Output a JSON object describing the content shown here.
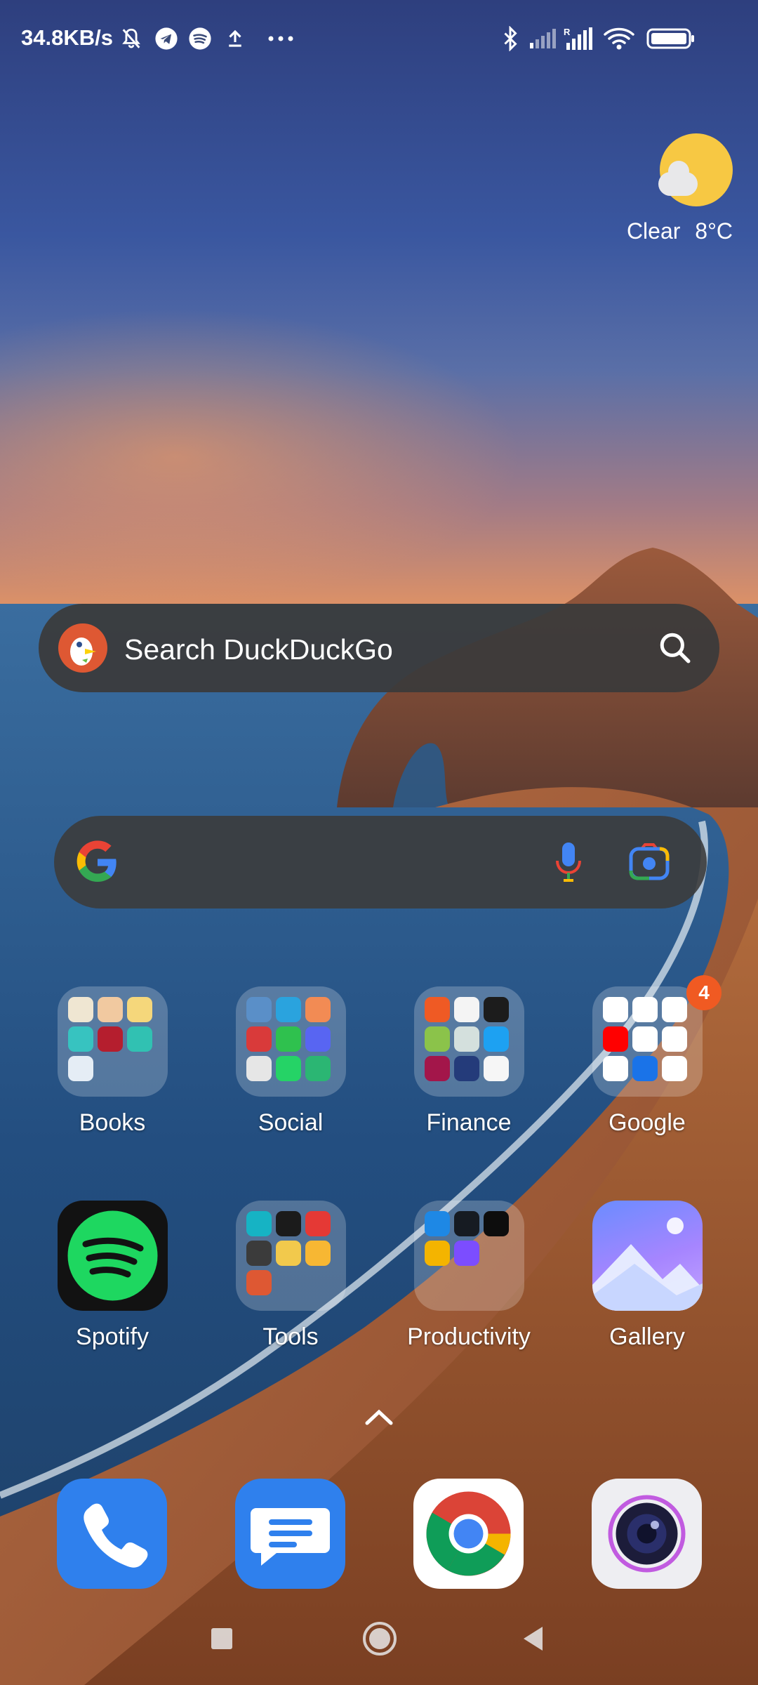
{
  "status_bar": {
    "net_speed": "34.8KB/s",
    "left_icons": [
      "mute-bell-icon",
      "telegram-icon",
      "spotify-icon",
      "upload-icon",
      "more-dots-icon"
    ],
    "right_icons": [
      "bluetooth-icon",
      "signal-1-icon",
      "signal-2-roaming-icon",
      "wifi-icon",
      "battery-icon"
    ]
  },
  "weather": {
    "condition": "Clear",
    "temperature": "8°C"
  },
  "ddg_widget": {
    "placeholder": "Search DuckDuckGo"
  },
  "google_widget": {
    "placeholder": ""
  },
  "apps": {
    "books": {
      "label": "Books"
    },
    "social": {
      "label": "Social"
    },
    "finance": {
      "label": "Finance"
    },
    "google": {
      "label": "Google",
      "badge": "4"
    },
    "spotify": {
      "label": "Spotify"
    },
    "tools": {
      "label": "Tools"
    },
    "productivity": {
      "label": "Productivity"
    },
    "gallery": {
      "label": "Gallery"
    }
  },
  "dock": [
    "phone-app",
    "messages-app",
    "chrome-app",
    "camera-app"
  ],
  "colors": {
    "spotify_green": "#1ed760",
    "google_badge": "#f05a22",
    "dock_blue": "#2f80ed",
    "sun": "#f7c843"
  }
}
